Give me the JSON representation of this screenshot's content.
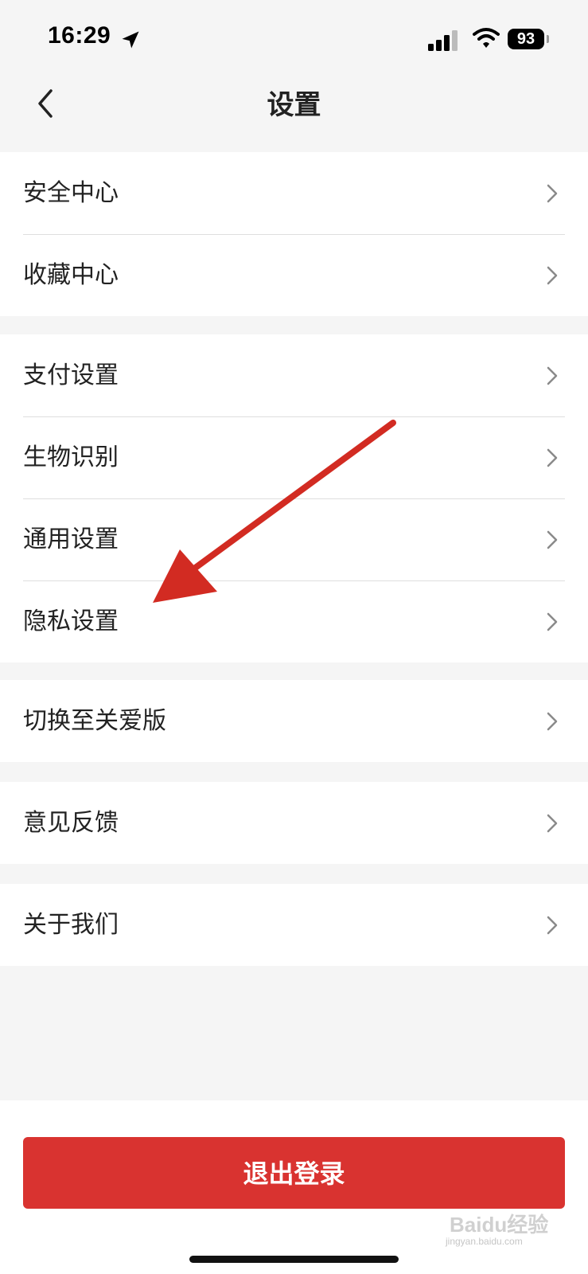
{
  "status_bar": {
    "time": "16:29",
    "battery": "93",
    "icons": [
      "location-arrow-icon",
      "cellular-signal-icon",
      "wifi-icon",
      "battery-icon"
    ]
  },
  "nav": {
    "title": "设置",
    "back_icon": "chevron-left-icon"
  },
  "groups": [
    {
      "items": [
        {
          "label": "安全中心"
        },
        {
          "label": "收藏中心"
        }
      ]
    },
    {
      "items": [
        {
          "label": "支付设置"
        },
        {
          "label": "生物识别"
        },
        {
          "label": "通用设置"
        },
        {
          "label": "隐私设置"
        }
      ]
    },
    {
      "items": [
        {
          "label": "切换至关爱版"
        }
      ]
    },
    {
      "items": [
        {
          "label": "意见反馈"
        }
      ]
    },
    {
      "items": [
        {
          "label": "关于我们"
        }
      ]
    }
  ],
  "logout": {
    "label": "退出登录"
  },
  "annotation": {
    "arrow_color": "#d22b22",
    "points_to": "隐私设置"
  },
  "watermark": {
    "text": "Baidu经验",
    "sub": "jingyan.baidu.com"
  },
  "colors": {
    "accent": "#d93330",
    "background": "#f5f5f5",
    "card": "#ffffff"
  }
}
